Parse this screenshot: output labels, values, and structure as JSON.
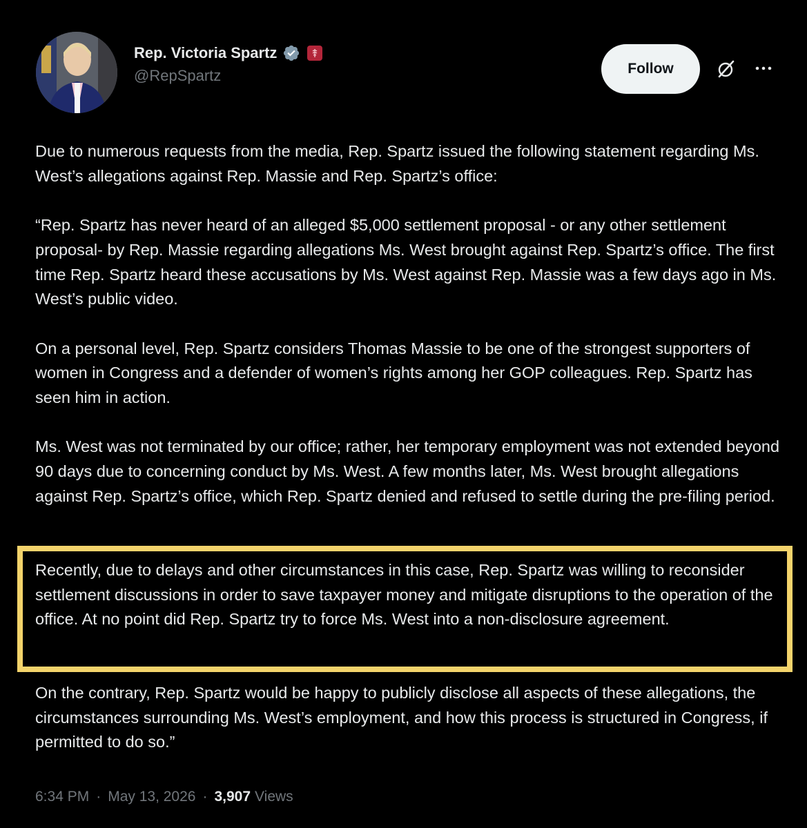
{
  "author": {
    "display_name": "Rep. Victoria Spartz",
    "handle": "@RepSpartz",
    "verified_icon": "verified-badge-icon",
    "affiliation_icon": "government-label-icon",
    "colors": {
      "verified": "#829aab",
      "affiliation": "#b3263a"
    }
  },
  "actions": {
    "follow_label": "Follow",
    "grok_icon": "grok-icon",
    "more_icon": "more-icon"
  },
  "tweet": {
    "paragraphs": [
      "Due to numerous requests from the media, Rep. Spartz issued the following statement regarding Ms. West’s allegations against Rep. Massie and Rep. Spartz’s office:",
      "“Rep. Spartz has never heard of an alleged $5,000 settlement proposal - or any other settlement proposal- by Rep. Massie regarding allegations Ms. West brought against Rep. Spartz’s office. The first time Rep. Spartz heard these accusations by Ms. West against Rep. Massie was a few days ago in Ms. West’s public video.",
      "On a personal level, Rep. Spartz considers Thomas Massie to be one of the strongest supporters of women in Congress and a defender of women’s rights among her GOP colleagues. Rep. Spartz has seen him in action.",
      "Ms. West was not terminated by our office; rather, her temporary employment was not extended beyond 90 days due to concerning conduct by Ms. West. A few months later, Ms. West brought allegations against Rep. Spartz’s office, which Rep. Spartz denied and refused to settle during the pre-filing period.",
      "Recently, due to delays and other circumstances in this case, Rep. Spartz was willing to reconsider settlement discussions in order to save taxpayer money and mitigate disruptions to the operation of the office. At no point did Rep. Spartz try to force Ms. West into a non-disclosure agreement.",
      "On the contrary, Rep. Spartz would be happy to publicly disclose all aspects of these allegations, the circumstances surrounding Ms. West’s employment, and how this process is structured in Congress, if permitted to do so.”"
    ],
    "highlight_color": "#f3d36b"
  },
  "meta": {
    "time": "6:34 PM",
    "separator": "·",
    "date": "May 13, 2026",
    "dot": "·",
    "views_count": "3,907",
    "views_label": "Views"
  }
}
